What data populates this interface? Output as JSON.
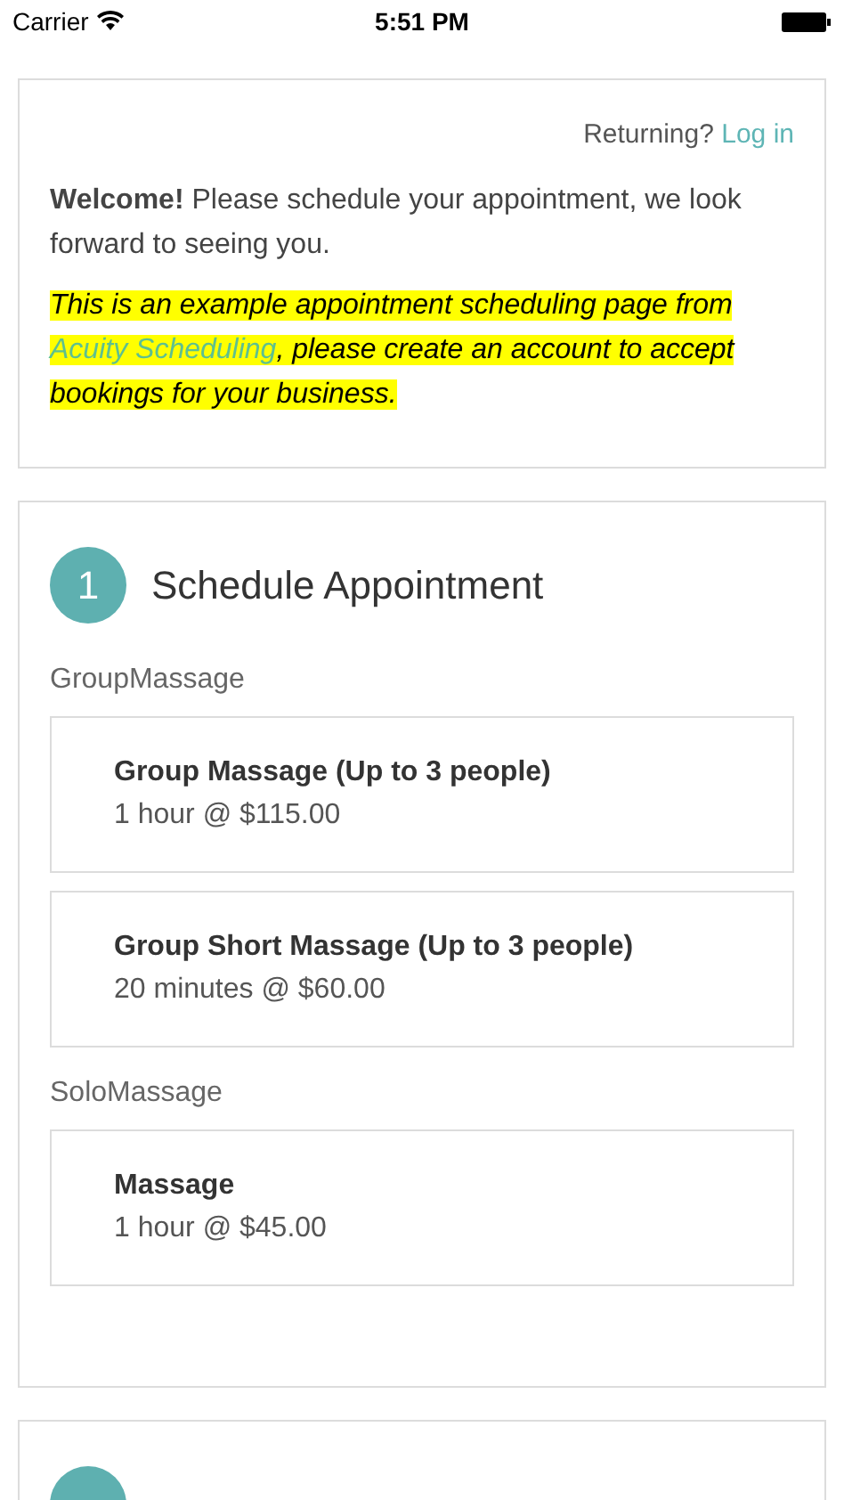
{
  "status_bar": {
    "carrier": "Carrier",
    "time": "5:51 PM"
  },
  "intro": {
    "returning": "Returning?",
    "login": "Log in",
    "welcome": "**Welcome!** Please schedule your appointment, we look forward to seeing you.",
    "note_before": "This is an example appointment scheduling page from ",
    "note_link": "Acuity Scheduling",
    "note_after": ", please create an account to accept bookings for your business."
  },
  "steps": [
    {
      "number": "1",
      "title": "Schedule Appointment",
      "groups": [
        {
          "name": "GroupMassage",
          "services": [
            {
              "title": "Group Massage (Up to 3 people)",
              "detail": "1 hour @ $115.00"
            },
            {
              "title": "Group Short Massage (Up to 3 people)",
              "detail": "20 minutes @ $60.00"
            }
          ]
        },
        {
          "name": "SoloMassage",
          "services": [
            {
              "title": "Massage",
              "detail": "1 hour @ $45.00"
            }
          ]
        }
      ]
    }
  ]
}
